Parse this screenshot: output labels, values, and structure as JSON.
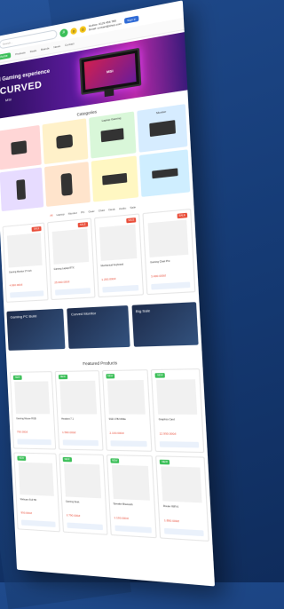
{
  "header": {
    "search_placeholder": "Search...",
    "search_button_glyph": "⌕",
    "contact_line1": "Hotline: 0123 456 789",
    "contact_line2": "Email: contact@shop.com",
    "signin_label": "Sign in",
    "cart_count": "0",
    "wishlist_count": "0"
  },
  "nav": {
    "active": "Home",
    "items": [
      "Products",
      "Deals",
      "Brands",
      "News",
      "Contact"
    ]
  },
  "hero": {
    "line1": "d Gaming experience",
    "line2": "CURVED",
    "line3": "MSI",
    "monitor_brand": "MSI"
  },
  "categories": {
    "title": "Categories",
    "items": [
      {
        "label": "",
        "color": "#ffd6d6"
      },
      {
        "label": "",
        "color": "#fff1c9"
      },
      {
        "label": "Laptop Gaming",
        "color": "#d9f7d9"
      },
      {
        "label": "Monitor",
        "color": "#d6ecff"
      },
      {
        "label": "",
        "color": "#e7dcff"
      },
      {
        "label": "",
        "color": "#ffe4cc"
      },
      {
        "label": "",
        "color": "#fff7c2"
      },
      {
        "label": "",
        "color": "#cfeeff"
      }
    ]
  },
  "product_tabs": [
    "All",
    "Laptop",
    "Monitor",
    "PC",
    "Gear",
    "Chair",
    "Desk",
    "Audio",
    "Sale"
  ],
  "products_row1": [
    {
      "name": "Gaming Monitor 27 inch",
      "price": "4.990.000đ"
    },
    {
      "name": "Gaming Laptop RTX",
      "price": "25.990.000đ"
    },
    {
      "name": "Mechanical Keyboard",
      "price": "1.290.000đ"
    },
    {
      "name": "Gaming Chair Pro",
      "price": "3.490.000đ"
    }
  ],
  "promos": [
    {
      "label": "Gaming PC Build"
    },
    {
      "label": "Curved Monitor"
    },
    {
      "label": "Big Sale"
    }
  ],
  "featured": {
    "title": "Featured Products"
  },
  "products_row2": [
    {
      "name": "Gaming Mouse RGB",
      "price": "790.000đ"
    },
    {
      "name": "Headset 7.1",
      "price": "1.590.000đ"
    },
    {
      "name": "SSD 1TB NVMe",
      "price": "2.190.000đ"
    },
    {
      "name": "Graphics Card",
      "price": "12.990.000đ"
    }
  ],
  "products_row3": [
    {
      "name": "Webcam Full HD",
      "price": "990.000đ"
    },
    {
      "name": "Gaming Desk",
      "price": "2.790.000đ"
    },
    {
      "name": "Speaker Bluetooth",
      "price": "1.190.000đ"
    },
    {
      "name": "Router WiFi 6",
      "price": "1.890.000đ"
    }
  ],
  "badges": {
    "new": "NEW",
    "sale": "SALE"
  }
}
